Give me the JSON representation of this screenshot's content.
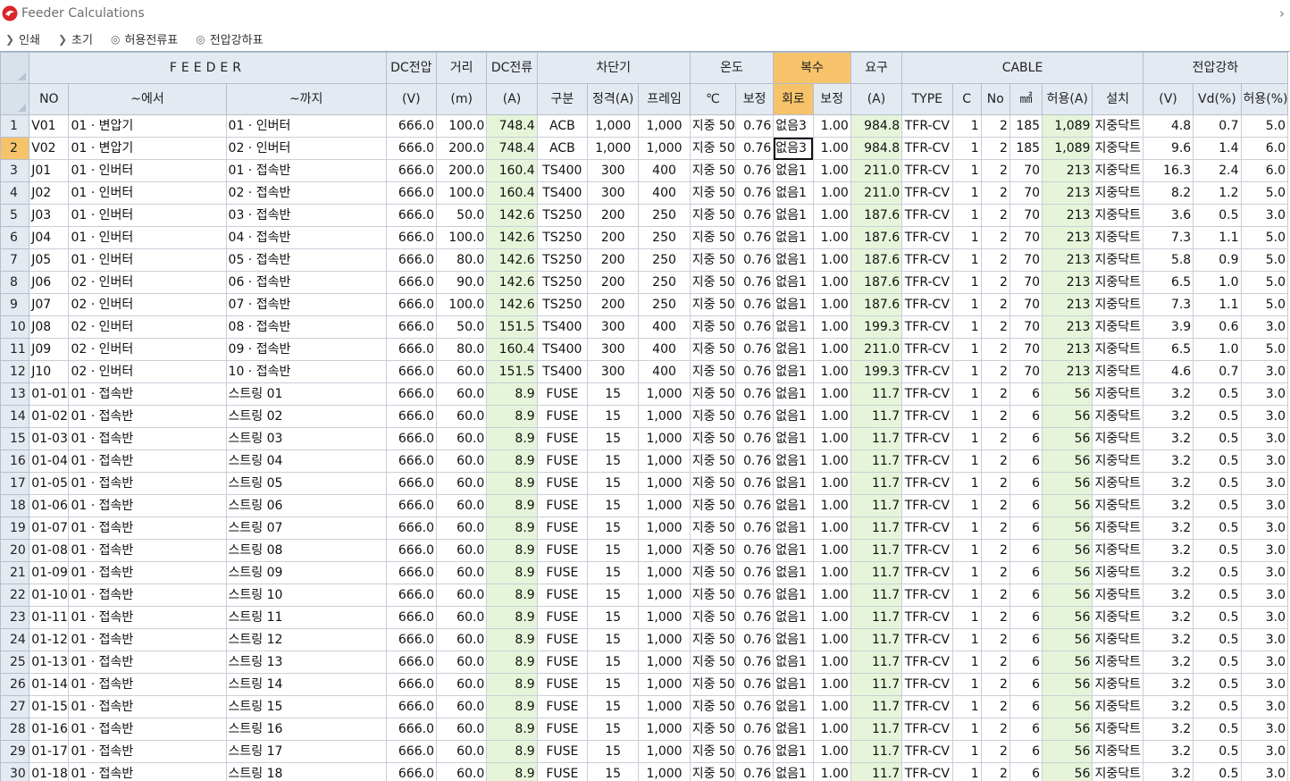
{
  "window": {
    "title": "Feeder Calculations",
    "close_glyph": "›"
  },
  "toolbar": [
    {
      "icon": "chevron-right-icon",
      "glyph": "❯",
      "label": "인쇄"
    },
    {
      "icon": "chevron-right-icon",
      "glyph": "❯",
      "label": "초기"
    },
    {
      "icon": "radio-icon",
      "glyph": "◎",
      "label": "허용전류표"
    },
    {
      "icon": "radio-icon",
      "glyph": "◎",
      "label": "전압강하표"
    }
  ],
  "header_groups": [
    {
      "key": "corner",
      "label": "",
      "span": 1
    },
    {
      "key": "feeder",
      "label": "FEEDER",
      "span": 3
    },
    {
      "key": "dc-voltage",
      "label": "DC전압",
      "span": 1
    },
    {
      "key": "distance",
      "label": "거리",
      "span": 1
    },
    {
      "key": "dc-current",
      "label": "DC전류",
      "span": 1
    },
    {
      "key": "breaker",
      "label": "차단기",
      "span": 3
    },
    {
      "key": "temperature",
      "label": "온도",
      "span": 2
    },
    {
      "key": "multiple",
      "label": "복수",
      "span": 2,
      "highlight": true
    },
    {
      "key": "required",
      "label": "요구",
      "span": 1
    },
    {
      "key": "cable",
      "label": "CABLE",
      "span": 6
    },
    {
      "key": "voltage-drop",
      "label": "전압강하",
      "span": 3
    }
  ],
  "columns": [
    {
      "key": "rownum",
      "label": "",
      "width": 32,
      "align": "l"
    },
    {
      "key": "no",
      "label": "NO",
      "width": 44,
      "align": "l"
    },
    {
      "key": "from",
      "label": "~에서",
      "width": 175,
      "align": "l"
    },
    {
      "key": "to",
      "label": "~까지",
      "width": 178,
      "align": "l"
    },
    {
      "key": "dcv",
      "label": "(V)",
      "width": 56,
      "align": "r"
    },
    {
      "key": "dist",
      "label": "(m)",
      "width": 56,
      "align": "r"
    },
    {
      "key": "dci",
      "label": "(A)",
      "width": 56,
      "align": "r",
      "green": true
    },
    {
      "key": "type",
      "label": "구분",
      "width": 56,
      "align": "c"
    },
    {
      "key": "rating",
      "label": "정격(A)",
      "width": 57,
      "align": "c"
    },
    {
      "key": "frame",
      "label": "프레임",
      "width": 57,
      "align": "c"
    },
    {
      "key": "temp",
      "label": "℃",
      "width": 51,
      "align": "l"
    },
    {
      "key": "tcorr",
      "label": "보정",
      "width": 42,
      "align": "r"
    },
    {
      "key": "circuit",
      "label": "회로",
      "width": 44,
      "align": "l",
      "highlight": true
    },
    {
      "key": "mcorr",
      "label": "보정",
      "width": 42,
      "align": "r"
    },
    {
      "key": "req",
      "label": "(A)",
      "width": 57,
      "align": "r",
      "green": true
    },
    {
      "key": "ctype",
      "label": "TYPE",
      "width": 56,
      "align": "c"
    },
    {
      "key": "c",
      "label": "C",
      "width": 32,
      "align": "r"
    },
    {
      "key": "cno",
      "label": "No",
      "width": 32,
      "align": "r"
    },
    {
      "key": "sq",
      "label": "㎟",
      "width": 36,
      "align": "r"
    },
    {
      "key": "allow",
      "label": "허용(A)",
      "width": 56,
      "align": "r",
      "green": true
    },
    {
      "key": "install",
      "label": "설치",
      "width": 56,
      "align": "l"
    },
    {
      "key": "vd_v",
      "label": "(V)",
      "width": 56,
      "align": "r"
    },
    {
      "key": "vd_pct",
      "label": "Vd(%)",
      "width": 53,
      "align": "r"
    },
    {
      "key": "allow_pct",
      "label": "허용(%)",
      "width": 52,
      "align": "r"
    }
  ],
  "rows": [
    [
      "1",
      "V01",
      "01 · 변압기",
      "01 · 인버터",
      "666.0",
      "100.0",
      "748.4",
      "ACB",
      "1,000",
      "1,000",
      "지중 50",
      "0.76",
      "없음3",
      "1.00",
      "984.8",
      "TFR-CV",
      "1",
      "2",
      "185",
      "1,089",
      "지중닥트",
      "4.8",
      "0.7",
      "5.0"
    ],
    [
      "2",
      "V02",
      "01 · 변압기",
      "02 · 인버터",
      "666.0",
      "200.0",
      "748.4",
      "ACB",
      "1,000",
      "1,000",
      "지중 50",
      "0.76",
      "없음3",
      "1.00",
      "984.8",
      "TFR-CV",
      "1",
      "2",
      "185",
      "1,089",
      "지중닥트",
      "9.6",
      "1.4",
      "6.0"
    ],
    [
      "3",
      "J01",
      "01 · 인버터",
      "01 · 접속반",
      "666.0",
      "200.0",
      "160.4",
      "TS400",
      "300",
      "400",
      "지중 50",
      "0.76",
      "없음1",
      "1.00",
      "211.0",
      "TFR-CV",
      "1",
      "2",
      "70",
      "213",
      "지중닥트",
      "16.3",
      "2.4",
      "6.0"
    ],
    [
      "4",
      "J02",
      "01 · 인버터",
      "02 · 접속반",
      "666.0",
      "100.0",
      "160.4",
      "TS400",
      "300",
      "400",
      "지중 50",
      "0.76",
      "없음1",
      "1.00",
      "211.0",
      "TFR-CV",
      "1",
      "2",
      "70",
      "213",
      "지중닥트",
      "8.2",
      "1.2",
      "5.0"
    ],
    [
      "5",
      "J03",
      "01 · 인버터",
      "03 · 접속반",
      "666.0",
      "50.0",
      "142.6",
      "TS250",
      "200",
      "250",
      "지중 50",
      "0.76",
      "없음1",
      "1.00",
      "187.6",
      "TFR-CV",
      "1",
      "2",
      "70",
      "213",
      "지중닥트",
      "3.6",
      "0.5",
      "3.0"
    ],
    [
      "6",
      "J04",
      "01 · 인버터",
      "04 · 접속반",
      "666.0",
      "100.0",
      "142.6",
      "TS250",
      "200",
      "250",
      "지중 50",
      "0.76",
      "없음1",
      "1.00",
      "187.6",
      "TFR-CV",
      "1",
      "2",
      "70",
      "213",
      "지중닥트",
      "7.3",
      "1.1",
      "5.0"
    ],
    [
      "7",
      "J05",
      "01 · 인버터",
      "05 · 접속반",
      "666.0",
      "80.0",
      "142.6",
      "TS250",
      "200",
      "250",
      "지중 50",
      "0.76",
      "없음1",
      "1.00",
      "187.6",
      "TFR-CV",
      "1",
      "2",
      "70",
      "213",
      "지중닥트",
      "5.8",
      "0.9",
      "5.0"
    ],
    [
      "8",
      "J06",
      "02 · 인버터",
      "06 · 접속반",
      "666.0",
      "90.0",
      "142.6",
      "TS250",
      "200",
      "250",
      "지중 50",
      "0.76",
      "없음1",
      "1.00",
      "187.6",
      "TFR-CV",
      "1",
      "2",
      "70",
      "213",
      "지중닥트",
      "6.5",
      "1.0",
      "5.0"
    ],
    [
      "9",
      "J07",
      "02 · 인버터",
      "07 · 접속반",
      "666.0",
      "100.0",
      "142.6",
      "TS250",
      "200",
      "250",
      "지중 50",
      "0.76",
      "없음1",
      "1.00",
      "187.6",
      "TFR-CV",
      "1",
      "2",
      "70",
      "213",
      "지중닥트",
      "7.3",
      "1.1",
      "5.0"
    ],
    [
      "10",
      "J08",
      "02 · 인버터",
      "08 · 접속반",
      "666.0",
      "50.0",
      "151.5",
      "TS400",
      "300",
      "400",
      "지중 50",
      "0.76",
      "없음1",
      "1.00",
      "199.3",
      "TFR-CV",
      "1",
      "2",
      "70",
      "213",
      "지중닥트",
      "3.9",
      "0.6",
      "3.0"
    ],
    [
      "11",
      "J09",
      "02 · 인버터",
      "09 · 접속반",
      "666.0",
      "80.0",
      "160.4",
      "TS400",
      "300",
      "400",
      "지중 50",
      "0.76",
      "없음1",
      "1.00",
      "211.0",
      "TFR-CV",
      "1",
      "2",
      "70",
      "213",
      "지중닥트",
      "6.5",
      "1.0",
      "5.0"
    ],
    [
      "12",
      "J10",
      "02 · 인버터",
      "10 · 접속반",
      "666.0",
      "60.0",
      "151.5",
      "TS400",
      "300",
      "400",
      "지중 50",
      "0.76",
      "없음1",
      "1.00",
      "199.3",
      "TFR-CV",
      "1",
      "2",
      "70",
      "213",
      "지중닥트",
      "4.6",
      "0.7",
      "3.0"
    ],
    [
      "13",
      "01-01",
      "01 · 접속반",
      "스트링 01",
      "666.0",
      "60.0",
      "8.9",
      "FUSE",
      "15",
      "1,000",
      "지중 50",
      "0.76",
      "없음1",
      "1.00",
      "11.7",
      "TFR-CV",
      "1",
      "2",
      "6",
      "56",
      "지중닥트",
      "3.2",
      "0.5",
      "3.0"
    ],
    [
      "14",
      "01-02",
      "01 · 접속반",
      "스트링 02",
      "666.0",
      "60.0",
      "8.9",
      "FUSE",
      "15",
      "1,000",
      "지중 50",
      "0.76",
      "없음1",
      "1.00",
      "11.7",
      "TFR-CV",
      "1",
      "2",
      "6",
      "56",
      "지중닥트",
      "3.2",
      "0.5",
      "3.0"
    ],
    [
      "15",
      "01-03",
      "01 · 접속반",
      "스트링 03",
      "666.0",
      "60.0",
      "8.9",
      "FUSE",
      "15",
      "1,000",
      "지중 50",
      "0.76",
      "없음1",
      "1.00",
      "11.7",
      "TFR-CV",
      "1",
      "2",
      "6",
      "56",
      "지중닥트",
      "3.2",
      "0.5",
      "3.0"
    ],
    [
      "16",
      "01-04",
      "01 · 접속반",
      "스트링 04",
      "666.0",
      "60.0",
      "8.9",
      "FUSE",
      "15",
      "1,000",
      "지중 50",
      "0.76",
      "없음1",
      "1.00",
      "11.7",
      "TFR-CV",
      "1",
      "2",
      "6",
      "56",
      "지중닥트",
      "3.2",
      "0.5",
      "3.0"
    ],
    [
      "17",
      "01-05",
      "01 · 접속반",
      "스트링 05",
      "666.0",
      "60.0",
      "8.9",
      "FUSE",
      "15",
      "1,000",
      "지중 50",
      "0.76",
      "없음1",
      "1.00",
      "11.7",
      "TFR-CV",
      "1",
      "2",
      "6",
      "56",
      "지중닥트",
      "3.2",
      "0.5",
      "3.0"
    ],
    [
      "18",
      "01-06",
      "01 · 접속반",
      "스트링 06",
      "666.0",
      "60.0",
      "8.9",
      "FUSE",
      "15",
      "1,000",
      "지중 50",
      "0.76",
      "없음1",
      "1.00",
      "11.7",
      "TFR-CV",
      "1",
      "2",
      "6",
      "56",
      "지중닥트",
      "3.2",
      "0.5",
      "3.0"
    ],
    [
      "19",
      "01-07",
      "01 · 접속반",
      "스트링 07",
      "666.0",
      "60.0",
      "8.9",
      "FUSE",
      "15",
      "1,000",
      "지중 50",
      "0.76",
      "없음1",
      "1.00",
      "11.7",
      "TFR-CV",
      "1",
      "2",
      "6",
      "56",
      "지중닥트",
      "3.2",
      "0.5",
      "3.0"
    ],
    [
      "20",
      "01-08",
      "01 · 접속반",
      "스트링 08",
      "666.0",
      "60.0",
      "8.9",
      "FUSE",
      "15",
      "1,000",
      "지중 50",
      "0.76",
      "없음1",
      "1.00",
      "11.7",
      "TFR-CV",
      "1",
      "2",
      "6",
      "56",
      "지중닥트",
      "3.2",
      "0.5",
      "3.0"
    ],
    [
      "21",
      "01-09",
      "01 · 접속반",
      "스트링 09",
      "666.0",
      "60.0",
      "8.9",
      "FUSE",
      "15",
      "1,000",
      "지중 50",
      "0.76",
      "없음1",
      "1.00",
      "11.7",
      "TFR-CV",
      "1",
      "2",
      "6",
      "56",
      "지중닥트",
      "3.2",
      "0.5",
      "3.0"
    ],
    [
      "22",
      "01-10",
      "01 · 접속반",
      "스트링 10",
      "666.0",
      "60.0",
      "8.9",
      "FUSE",
      "15",
      "1,000",
      "지중 50",
      "0.76",
      "없음1",
      "1.00",
      "11.7",
      "TFR-CV",
      "1",
      "2",
      "6",
      "56",
      "지중닥트",
      "3.2",
      "0.5",
      "3.0"
    ],
    [
      "23",
      "01-11",
      "01 · 접속반",
      "스트링 11",
      "666.0",
      "60.0",
      "8.9",
      "FUSE",
      "15",
      "1,000",
      "지중 50",
      "0.76",
      "없음1",
      "1.00",
      "11.7",
      "TFR-CV",
      "1",
      "2",
      "6",
      "56",
      "지중닥트",
      "3.2",
      "0.5",
      "3.0"
    ],
    [
      "24",
      "01-12",
      "01 · 접속반",
      "스트링 12",
      "666.0",
      "60.0",
      "8.9",
      "FUSE",
      "15",
      "1,000",
      "지중 50",
      "0.76",
      "없음1",
      "1.00",
      "11.7",
      "TFR-CV",
      "1",
      "2",
      "6",
      "56",
      "지중닥트",
      "3.2",
      "0.5",
      "3.0"
    ],
    [
      "25",
      "01-13",
      "01 · 접속반",
      "스트링 13",
      "666.0",
      "60.0",
      "8.9",
      "FUSE",
      "15",
      "1,000",
      "지중 50",
      "0.76",
      "없음1",
      "1.00",
      "11.7",
      "TFR-CV",
      "1",
      "2",
      "6",
      "56",
      "지중닥트",
      "3.2",
      "0.5",
      "3.0"
    ],
    [
      "26",
      "01-14",
      "01 · 접속반",
      "스트링 14",
      "666.0",
      "60.0",
      "8.9",
      "FUSE",
      "15",
      "1,000",
      "지중 50",
      "0.76",
      "없음1",
      "1.00",
      "11.7",
      "TFR-CV",
      "1",
      "2",
      "6",
      "56",
      "지중닥트",
      "3.2",
      "0.5",
      "3.0"
    ],
    [
      "27",
      "01-15",
      "01 · 접속반",
      "스트링 15",
      "666.0",
      "60.0",
      "8.9",
      "FUSE",
      "15",
      "1,000",
      "지중 50",
      "0.76",
      "없음1",
      "1.00",
      "11.7",
      "TFR-CV",
      "1",
      "2",
      "6",
      "56",
      "지중닥트",
      "3.2",
      "0.5",
      "3.0"
    ],
    [
      "28",
      "01-16",
      "01 · 접속반",
      "스트링 16",
      "666.0",
      "60.0",
      "8.9",
      "FUSE",
      "15",
      "1,000",
      "지중 50",
      "0.76",
      "없음1",
      "1.00",
      "11.7",
      "TFR-CV",
      "1",
      "2",
      "6",
      "56",
      "지중닥트",
      "3.2",
      "0.5",
      "3.0"
    ],
    [
      "29",
      "01-17",
      "01 · 접속반",
      "스트링 17",
      "666.0",
      "60.0",
      "8.9",
      "FUSE",
      "15",
      "1,000",
      "지중 50",
      "0.76",
      "없음1",
      "1.00",
      "11.7",
      "TFR-CV",
      "1",
      "2",
      "6",
      "56",
      "지중닥트",
      "3.2",
      "0.5",
      "3.0"
    ],
    [
      "30",
      "01-18",
      "01 · 접속반",
      "스트링 18",
      "666.0",
      "60.0",
      "8.9",
      "FUSE",
      "15",
      "1,000",
      "지중 50",
      "0.76",
      "없음1",
      "1.00",
      "11.7",
      "TFR-CV",
      "1",
      "2",
      "6",
      "56",
      "지중닥트",
      "3.2",
      "0.5",
      "3.0"
    ]
  ],
  "selection": {
    "row": 1,
    "col": 12
  },
  "colors": {
    "header_bg": "#e4eaf2",
    "highlight": "#f6c36b",
    "green_cell": "#e6f5d9",
    "grid_line": "#c9cfd8"
  }
}
